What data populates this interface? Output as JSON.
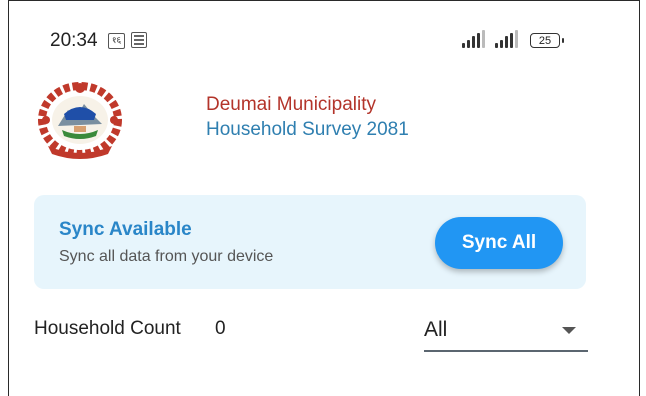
{
  "status_bar": {
    "time": "20:34",
    "notif_icon_text": "१६",
    "battery_level": "25"
  },
  "header": {
    "organization": "Deumai Municipality",
    "survey_title": "Household Survey 2081"
  },
  "sync": {
    "title": "Sync Available",
    "subtitle": "Sync all data from your device",
    "button_label": "Sync All"
  },
  "household": {
    "label": "Household Count",
    "count": "0"
  },
  "filter": {
    "selected": "All"
  },
  "colors": {
    "org_red": "#b3342a",
    "survey_blue": "#2f7fb0",
    "accent": "#2196f3",
    "card_bg": "#e7f5fc"
  }
}
